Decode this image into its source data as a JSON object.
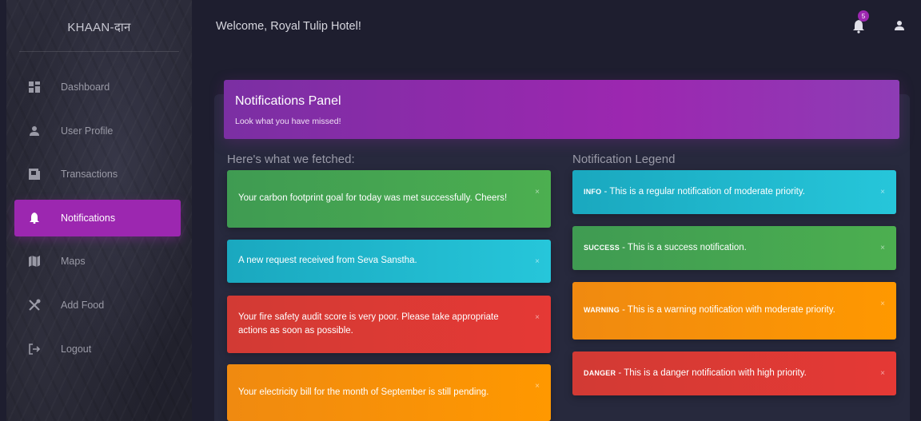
{
  "app": {
    "logo": "KHAAN-दान",
    "welcome": "Welcome, Royal Tulip Hotel!",
    "notification_count": "5"
  },
  "sidebar": {
    "items": [
      {
        "label": "Dashboard",
        "icon": "dashboard-icon",
        "active": false
      },
      {
        "label": "User Profile",
        "icon": "person-icon",
        "active": false
      },
      {
        "label": "Transactions",
        "icon": "receipt-icon",
        "active": false
      },
      {
        "label": "Notifications",
        "icon": "bell-icon",
        "active": true
      },
      {
        "label": "Maps",
        "icon": "map-icon",
        "active": false
      },
      {
        "label": "Add Food",
        "icon": "utensils-icon",
        "active": false
      },
      {
        "label": "Logout",
        "icon": "logout-icon",
        "active": false
      }
    ]
  },
  "panel": {
    "title": "Notifications Panel",
    "subtitle": "Look what you have missed!"
  },
  "fetched": {
    "title": "Here's what we fetched:",
    "items": [
      {
        "text": "Your carbon footprint goal for today was met successfully. Cheers!",
        "type": "green"
      },
      {
        "text": "A new request received from Seva Sanstha.",
        "type": "cyan"
      },
      {
        "text": "Your fire safety audit score is very poor. Please take appropriate actions as soon as possible.",
        "type": "red"
      },
      {
        "text": "Your electricity bill for the month of September is still pending.",
        "type": "orange"
      }
    ]
  },
  "legend": {
    "title": "Notification Legend",
    "items": [
      {
        "tag": "INFO",
        "text": " - This is a regular notification of moderate priority.",
        "type": "cyan"
      },
      {
        "tag": "SUCCESS",
        "text": " - This is a success notification.",
        "type": "green"
      },
      {
        "tag": "WARNING",
        "text": " - This is a warning notification with moderate priority.",
        "type": "orange"
      },
      {
        "tag": "DANGER",
        "text": " - This is a danger notification with high priority.",
        "type": "red"
      }
    ]
  },
  "close_glyph": "×",
  "colors": {
    "accent": "#9c27b0",
    "success": "#4caf50",
    "info": "#26c6da",
    "danger": "#e53935",
    "warning": "#ff9800",
    "background": "#1e1e2f"
  }
}
